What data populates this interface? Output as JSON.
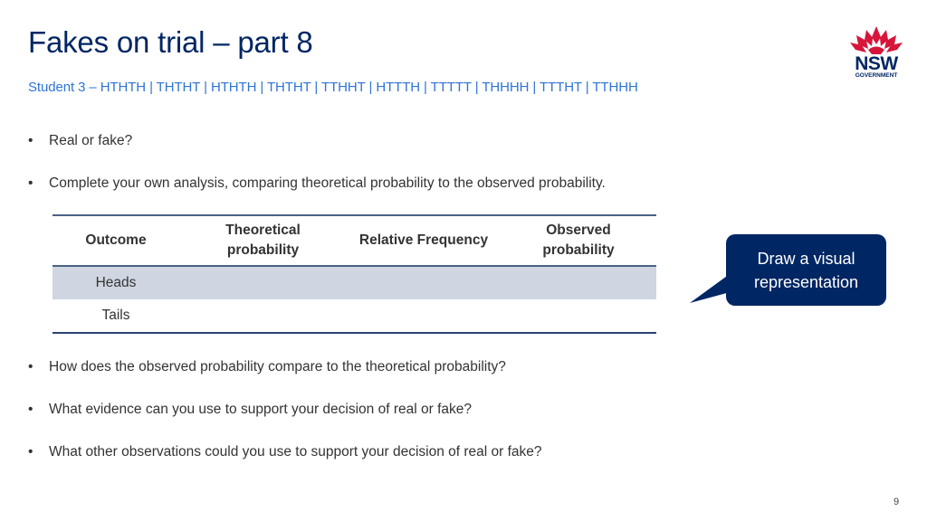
{
  "header": {
    "title": "Fakes on trial – part 8",
    "subtitle": "Student 3 – HTHTH | THTHT | HTHTH | THTHT | TTHHT | HTTTH | TTTTT | THHHH | TTTHT | TTHHH"
  },
  "logo": {
    "icon": "waratah-icon",
    "name": "NSW",
    "sub": "GOVERNMENT",
    "colors": {
      "flower": "#d7153a",
      "text": "#002664"
    }
  },
  "bullets_top": [
    {
      "icon": "bullet-dot",
      "text": "Real or fake?"
    },
    {
      "icon": "bullet-dot",
      "text": "Complete your own analysis, comparing theoretical probability to the observed probability."
    }
  ],
  "table": {
    "headers": [
      [
        "Outcome"
      ],
      [
        "Theoretical",
        "probability"
      ],
      [
        "Relative Frequency"
      ],
      [
        "Observed",
        "probability"
      ]
    ],
    "rows": [
      {
        "outcome": "Heads",
        "theoretical": "",
        "relative": "",
        "observed": ""
      },
      {
        "outcome": "Tails",
        "theoretical": "",
        "relative": "",
        "observed": ""
      }
    ]
  },
  "callout": {
    "line1": "Draw a visual",
    "line2": "representation",
    "color": "#002664"
  },
  "bullets_bottom": [
    {
      "icon": "bullet-dot",
      "text": "How does the observed probability compare to the theoretical probability?"
    },
    {
      "icon": "bullet-dot",
      "text": "What evidence can you use to support your decision of real or fake?"
    },
    {
      "icon": "bullet-dot",
      "text": "What other observations could you use to support your decision of real or fake?"
    }
  ],
  "footer": {
    "page_number": "9"
  }
}
